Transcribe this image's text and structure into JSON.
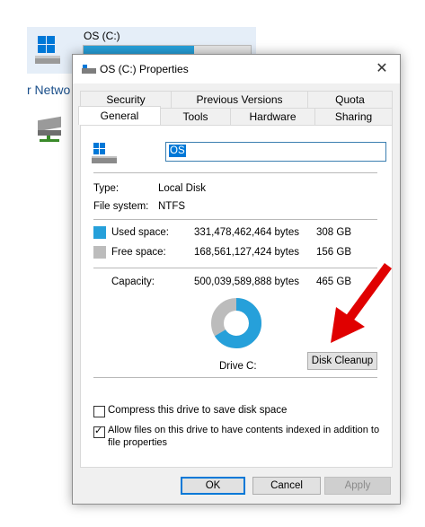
{
  "explorer": {
    "drive_name": "OS (C:)",
    "drive_used_fraction": 0.66,
    "network_text": "r Netwo"
  },
  "dialog": {
    "title": "OS (C:) Properties",
    "tabs_row1": [
      "Security",
      "Previous Versions",
      "Quota"
    ],
    "tabs_row2": [
      "General",
      "Tools",
      "Hardware",
      "Sharing"
    ],
    "active_tab": "General",
    "name_value": "OS",
    "type_label": "Type:",
    "type_value": "Local Disk",
    "fs_label": "File system:",
    "fs_value": "NTFS",
    "used_label": "Used space:",
    "used_bytes": "331,478,462,464 bytes",
    "used_gb": "308 GB",
    "free_label": "Free space:",
    "free_bytes": "168,561,127,424 bytes",
    "free_gb": "156 GB",
    "capacity_label": "Capacity:",
    "capacity_bytes": "500,039,589,888 bytes",
    "capacity_gb": "465 GB",
    "drive_label": "Drive C:",
    "cleanup_button": "Disk Cleanup",
    "compress_label": "Compress this drive to save disk space",
    "compress_checked": false,
    "index_label_line1": "Allow files on this drive to have contents indexed in addition to",
    "index_label_line2": "file properties",
    "index_checked": true,
    "ok_button": "OK",
    "cancel_button": "Cancel",
    "apply_button": "Apply",
    "close_symbol": "✕",
    "colors": {
      "used": "#26a0da",
      "free": "#bcbcbc",
      "arrow": "#e00000"
    },
    "used_fraction": 0.663
  }
}
